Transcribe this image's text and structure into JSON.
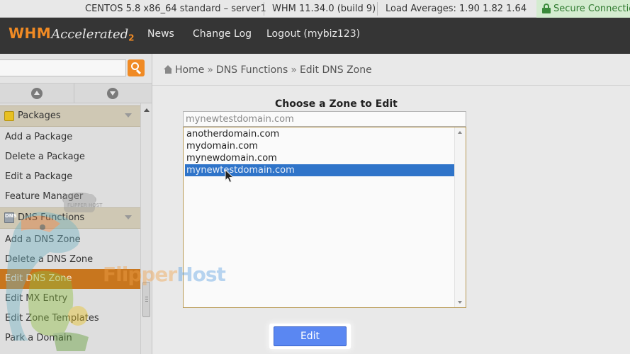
{
  "status_bar": {
    "os_info": "CENTOS 5.8 x86_64 standard – server1",
    "version": "WHM 11.34.0 (build 9)",
    "load_averages": "Load Averages: 1.90 1.82 1.64",
    "secure": "Secure Connection"
  },
  "header": {
    "logo": {
      "whm": "WHM",
      "accelerated": "Accelerated",
      "two": "2"
    },
    "nav": [
      "News",
      "Change Log",
      "Logout (mybiz123)"
    ],
    "accent_color": "#f08a24"
  },
  "breadcrumb": {
    "home": "Home",
    "section": "DNS Functions",
    "page": "Edit DNS Zone",
    "separator": "»"
  },
  "sidebar": {
    "search_value": "",
    "sections": [
      {
        "title": "Packages",
        "icon": "package-icon",
        "items": [
          "Add a Package",
          "Delete a Package",
          "Edit a Package",
          "Feature Manager"
        ]
      },
      {
        "title": "DNS Functions",
        "icon": "dns-icon",
        "icon_text": "DNS",
        "items": [
          "Add a DNS Zone",
          "Delete a DNS Zone",
          "Edit DNS Zone",
          "Edit MX Entry",
          "Edit Zone Templates",
          "Park a Domain"
        ]
      }
    ],
    "active_item": "Edit DNS Zone",
    "active_color": "#c8761e"
  },
  "main": {
    "heading": "Choose a Zone to Edit",
    "zone_input_value": "mynewtestdomain.com",
    "zones": [
      "anotherdomain.com",
      "mydomain.com",
      "mynewdomain.com",
      "mynewtestdomain.com"
    ],
    "selected_zone": "mynewtestdomain.com",
    "selection_color": "#2f74c9",
    "edit_button": "Edit",
    "button_color": "#5a87f2"
  },
  "watermark": {
    "flipper": "Flipper",
    "host": "Host",
    "badge": "FLIPPER HOST"
  }
}
